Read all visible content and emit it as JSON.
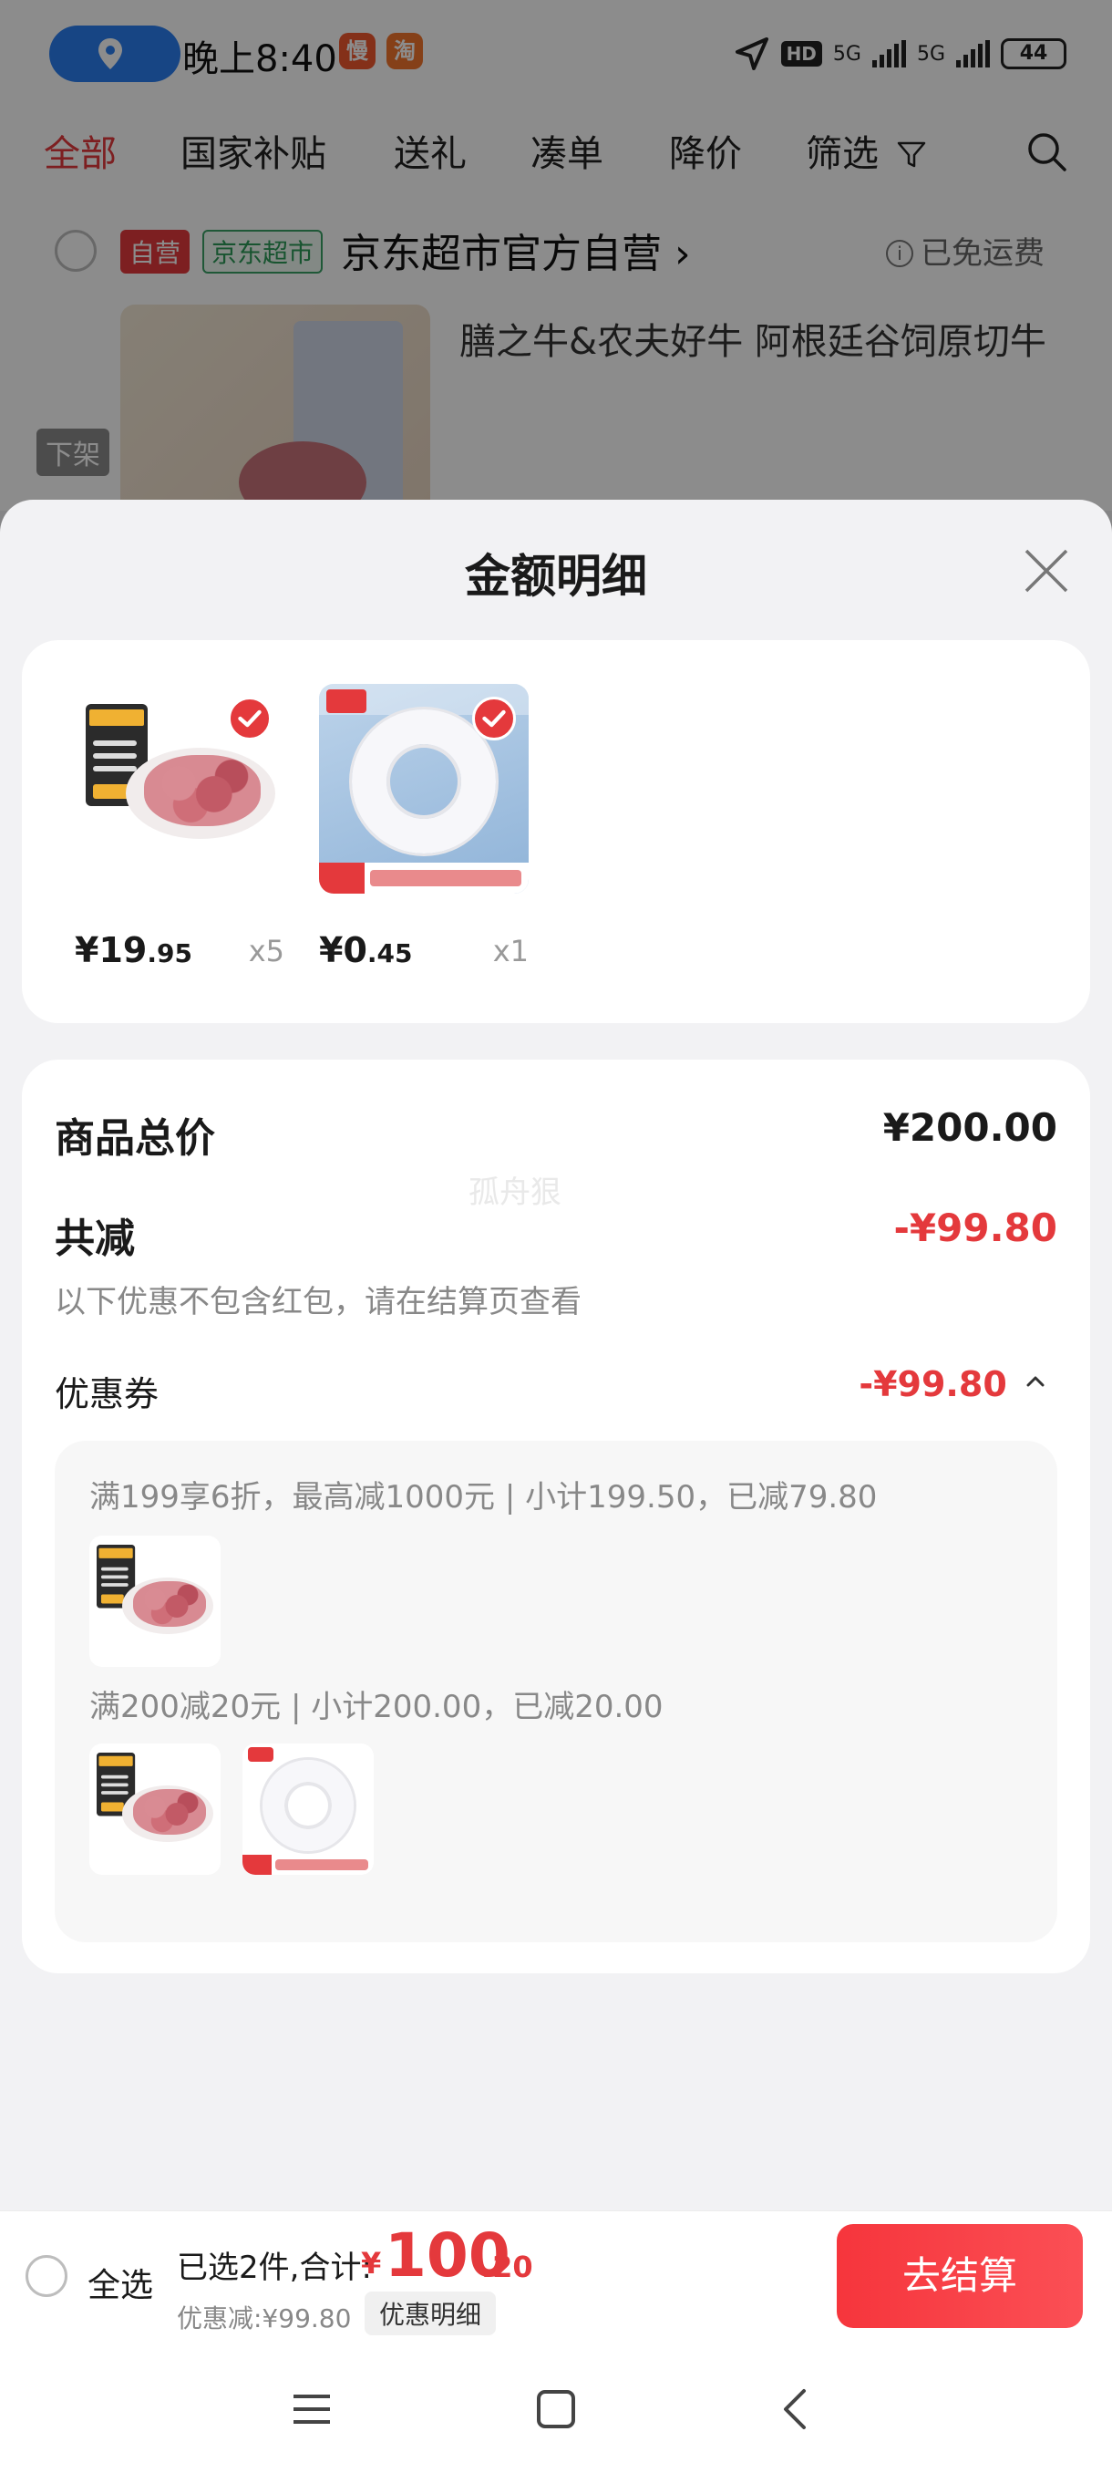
{
  "status_bar": {
    "time": "晚上8:40",
    "badge_1": "慢",
    "badge_2": "淘",
    "hd": "HD",
    "net_1": "5G",
    "net_2": "5G",
    "battery": "44"
  },
  "tabs": [
    {
      "label": "全部"
    },
    {
      "label": "国家补贴"
    },
    {
      "label": "送礼"
    },
    {
      "label": "凑单"
    },
    {
      "label": "降价"
    },
    {
      "label": "筛选"
    }
  ],
  "store": {
    "self_tag": "自营",
    "market_tag": "京东超市",
    "name": "京东超市官方自营",
    "chevron": "›",
    "free_shipping": "已免运费",
    "info_glyph": "i",
    "product_title": "膳之牛&农夫好牛 阿根廷谷饲原切牛",
    "offline_tag": "下架"
  },
  "sheet": {
    "title": "金额明细",
    "products": [
      {
        "price_int": "¥19",
        "price_dec": ".95",
        "qty": "x5",
        "icon": "beef-product-image"
      },
      {
        "price_int": "¥0",
        "price_dec": ".45",
        "qty": "x1",
        "icon": "tape-product-image"
      }
    ],
    "total_label": "商品总价",
    "total_value": "¥200.00",
    "watermark": "孤舟狠",
    "reduce_label": "共减",
    "reduce_value": "-¥99.80",
    "note": "以下优惠不包含红包，请在结算页查看",
    "coupon_label": "优惠券",
    "coupon_value": "-¥99.80",
    "rules": [
      {
        "text": "满199享6折，最高减1000元 | 小计199.50，已减79.80"
      },
      {
        "text": "满200减20元 | 小计200.00，已减20.00"
      }
    ]
  },
  "bottom": {
    "select_all": "全选",
    "selected": "已选2件,合计:",
    "currency": "¥",
    "total_int": "100",
    "total_dec": ".20",
    "discount": "优惠减:¥99.80",
    "discount_detail": "优惠明细",
    "checkout": "去结算"
  },
  "colors": {
    "accent": "#e4393c",
    "brand_green": "#2d9a58",
    "location_blue": "#2b7ff0"
  }
}
